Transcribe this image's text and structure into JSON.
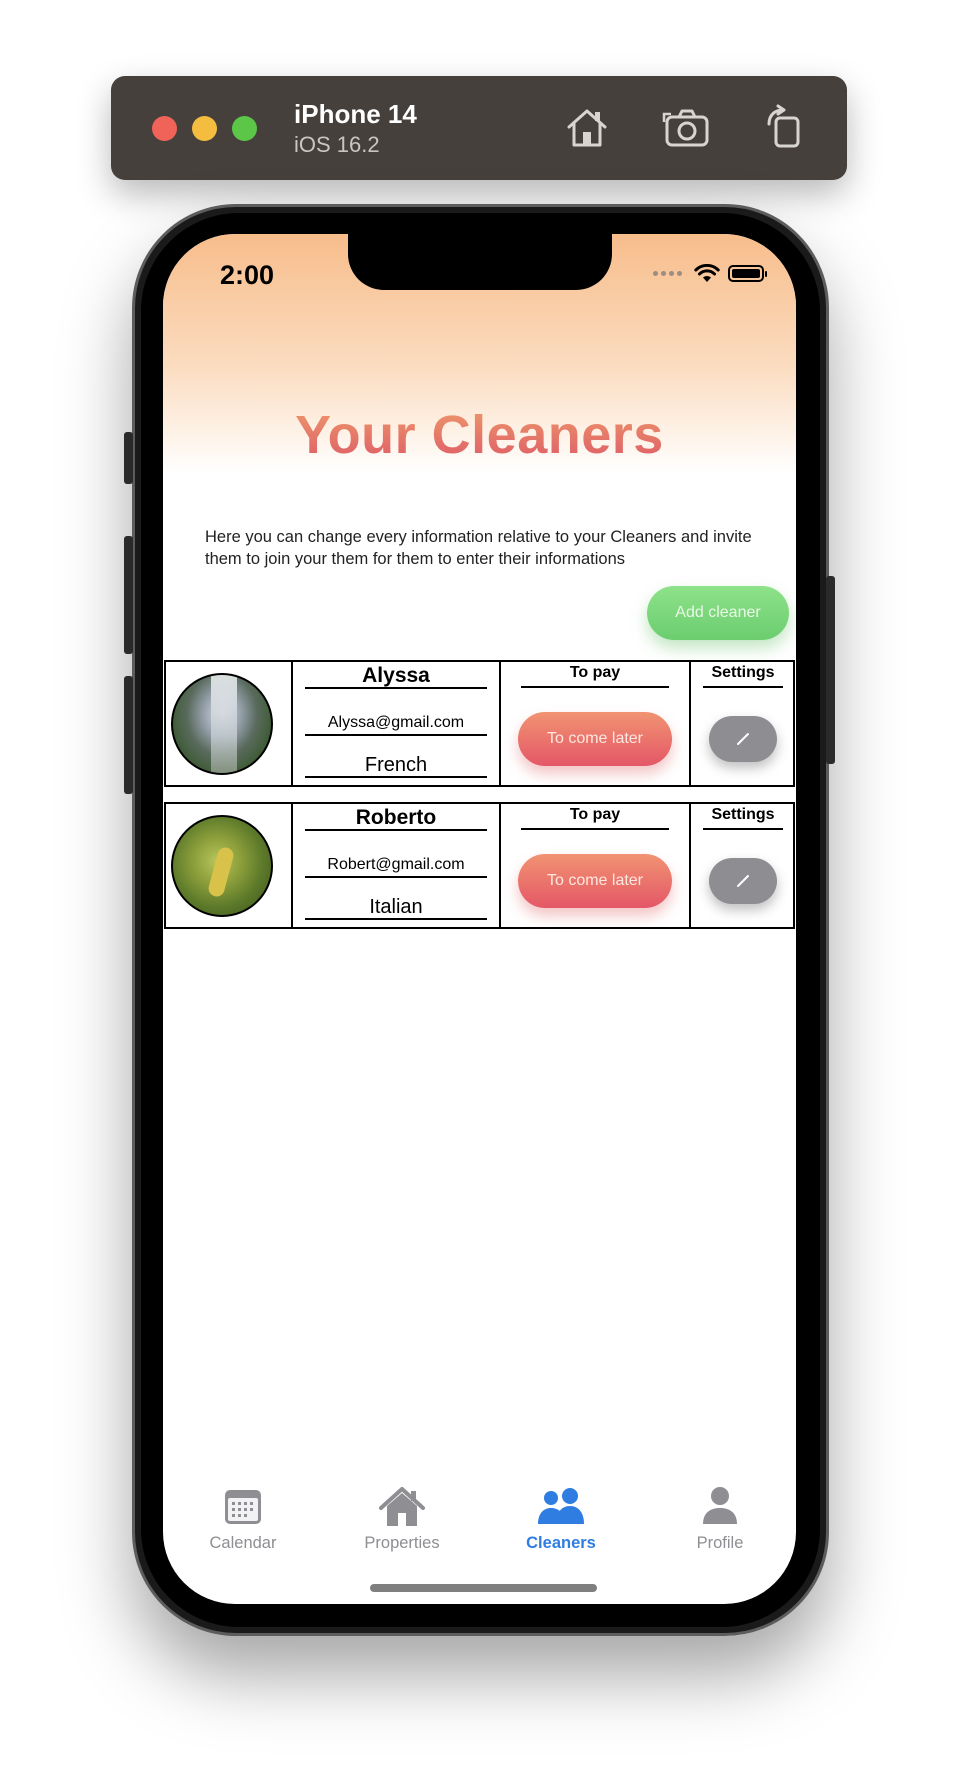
{
  "simulator": {
    "device_name": "iPhone 14",
    "os_version": "iOS 16.2",
    "buttons": [
      "home-icon",
      "camera-icon",
      "rotate-icon"
    ]
  },
  "status_bar": {
    "time": "2:00",
    "icons": [
      "signal-dots-icon",
      "wifi-icon",
      "battery-icon"
    ]
  },
  "page": {
    "title": "Your Cleaners",
    "description": "Here you can change every information relative to your Cleaners and invite them to join your them for them to enter their informations",
    "add_button_label": "Add cleaner"
  },
  "columns": {
    "pay_header": "To pay",
    "settings_header": "Settings"
  },
  "cleaners": [
    {
      "name": "Alyssa",
      "email": "Alyssa@gmail.com",
      "language": "French",
      "pay_label": "To come later",
      "photo": "waterfall-photo"
    },
    {
      "name": "Roberto",
      "email": "Robert@gmail.com",
      "language": "Italian",
      "pay_label": "To come later",
      "photo": "leaves-photo"
    }
  ],
  "tabs": [
    {
      "label": "Calendar",
      "icon": "calendar-icon",
      "active": false
    },
    {
      "label": "Properties",
      "icon": "house-icon",
      "active": false
    },
    {
      "label": "Cleaners",
      "icon": "people-icon",
      "active": true
    },
    {
      "label": "Profile",
      "icon": "person-icon",
      "active": false
    }
  ],
  "colors": {
    "accent_active_tab": "#2f7de1",
    "tab_inactive": "#8e8e93",
    "add_button": "#7dd67b",
    "pay_button": "#e76f6b",
    "settings_button": "#8e8d92",
    "header_gradient_top": "#f7bd8b"
  }
}
